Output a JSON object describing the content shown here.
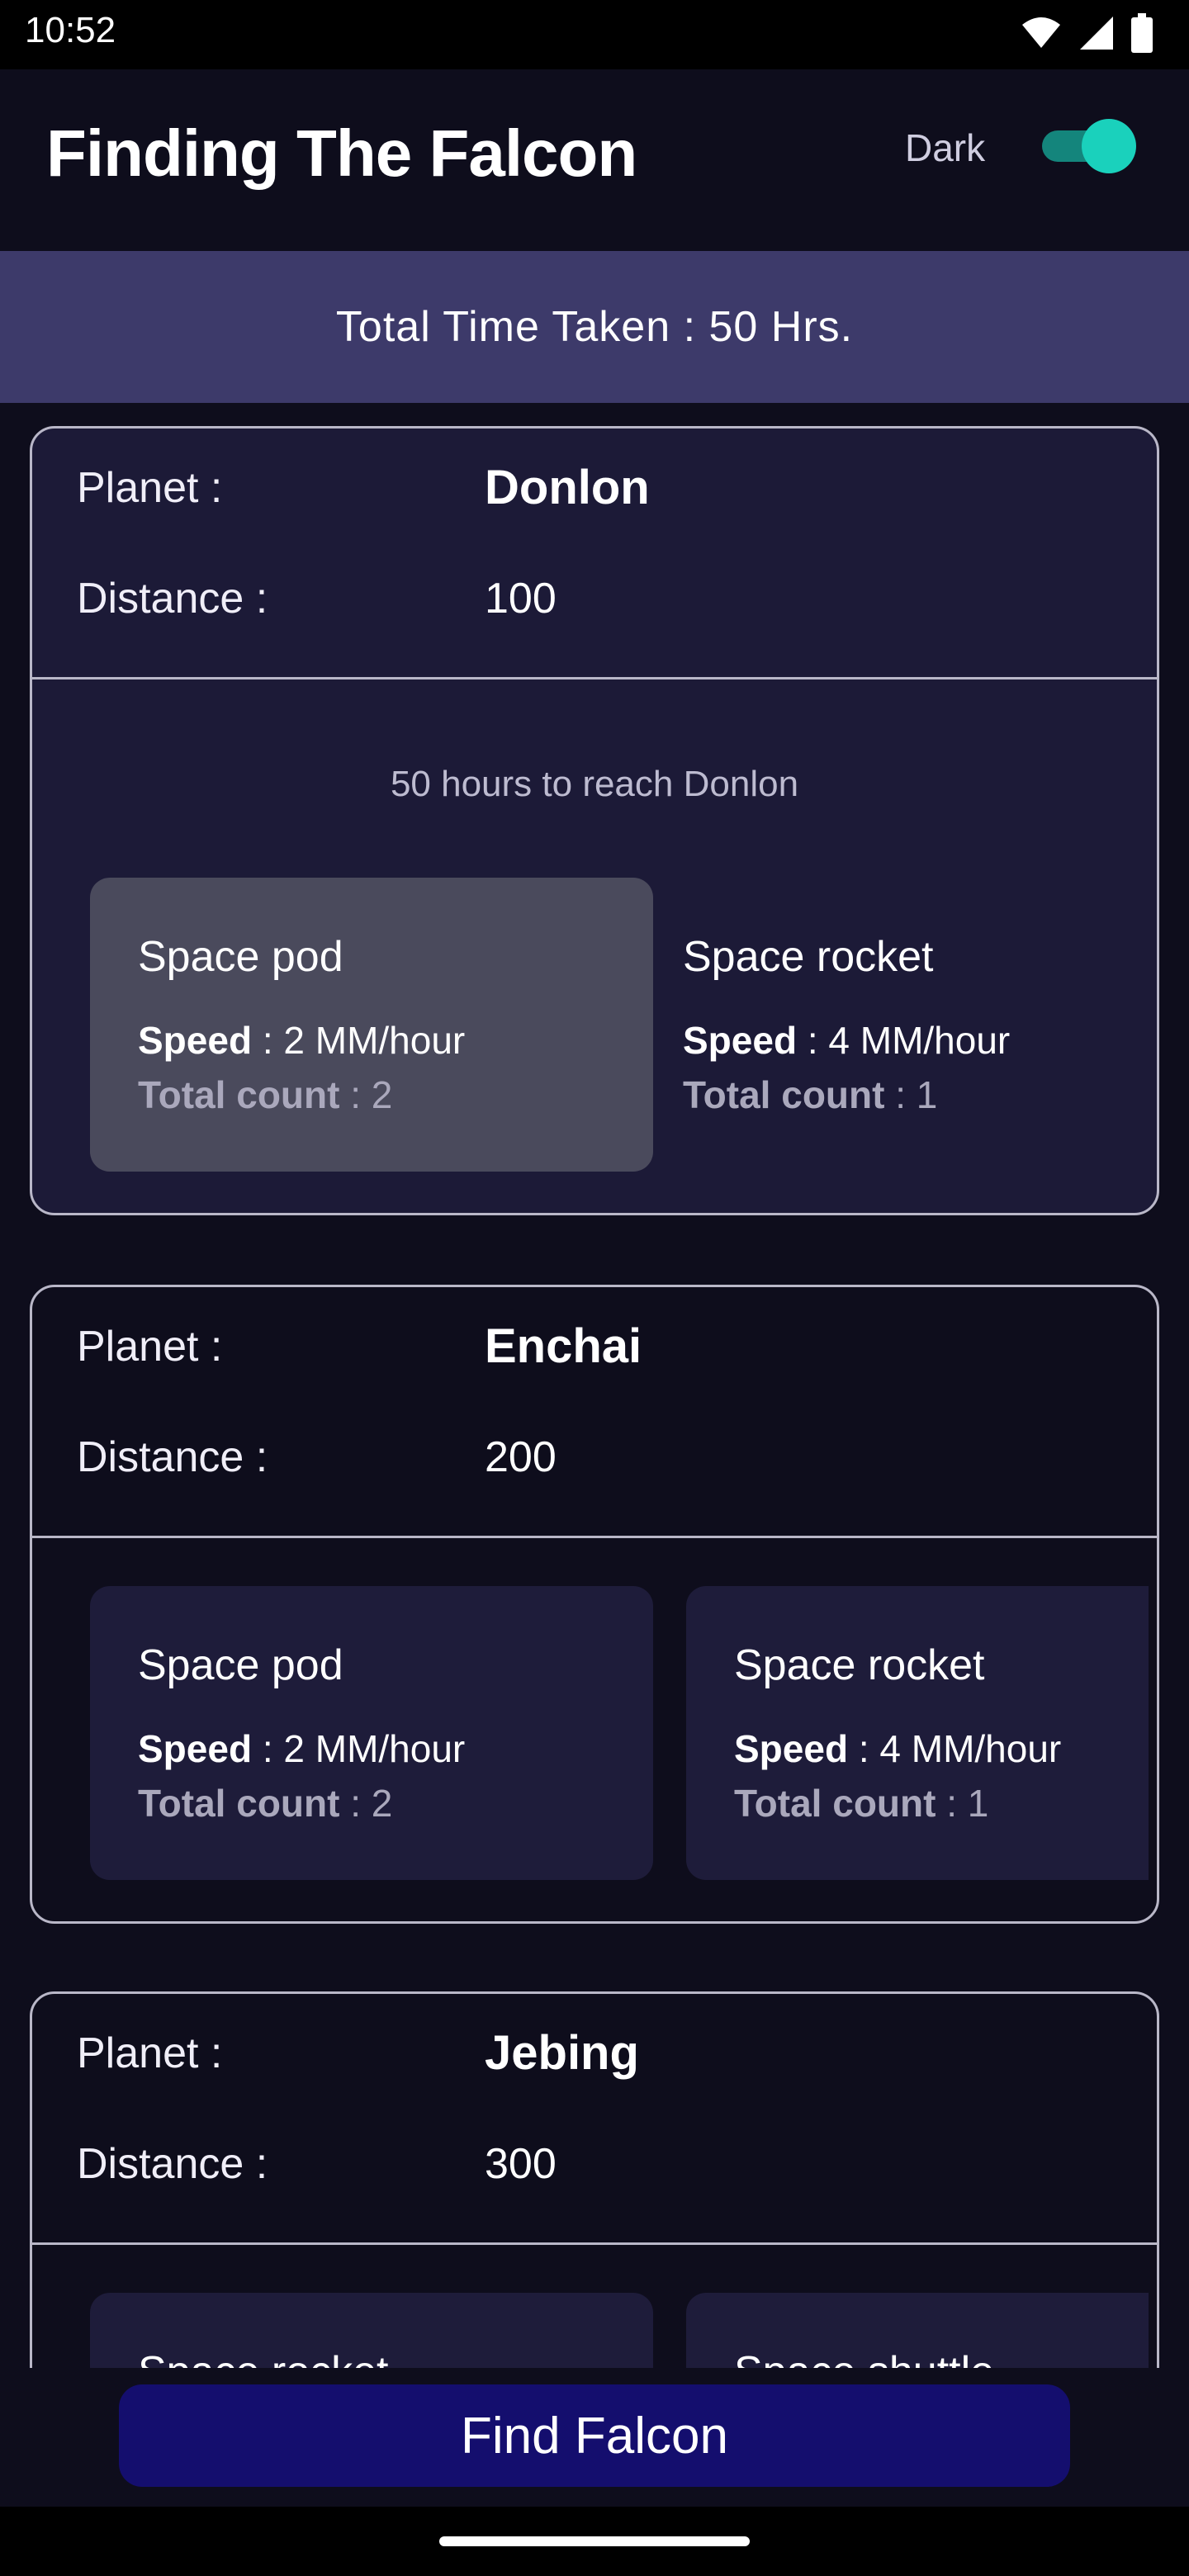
{
  "status_bar": {
    "time": "10:52",
    "icons": [
      "wifi-icon",
      "signal-icon",
      "battery-icon"
    ]
  },
  "app_bar": {
    "title": "Finding The Falcon",
    "theme_label": "Dark",
    "dark_mode_on": true
  },
  "banner": {
    "total_time": "Total Time Taken : 50 Hrs."
  },
  "labels": {
    "planet": "Planet :",
    "distance": "Distance :",
    "speed": "Speed",
    "total_count": "Total count"
  },
  "destinations": [
    {
      "planet": "Donlon",
      "distance": "100",
      "hint": "50 hours to reach Donlon",
      "vehicles": [
        {
          "name": "Space pod",
          "speed": ": 2 MM/hour",
          "count": ": 2",
          "selected": true
        },
        {
          "name": "Space rocket",
          "speed": ": 4 MM/hour",
          "count": ": 1",
          "selected": false
        }
      ]
    },
    {
      "planet": "Enchai",
      "distance": "200",
      "vehicles": [
        {
          "name": "Space pod",
          "speed": ": 2 MM/hour",
          "count": ": 2"
        },
        {
          "name": "Space rocket",
          "speed": ": 4 MM/hour",
          "count": ": 1"
        }
      ]
    },
    {
      "planet": "Jebing",
      "distance": "300",
      "vehicles": [
        {
          "name": "Space rocket"
        },
        {
          "name": "Space shuttle"
        }
      ]
    }
  ],
  "action": {
    "find_label": "Find Falcon"
  },
  "colors": {
    "background": "#0e0d1c",
    "banner": "#3d3a6a",
    "button": "#140e6e",
    "switch": "#1ad1bc"
  }
}
